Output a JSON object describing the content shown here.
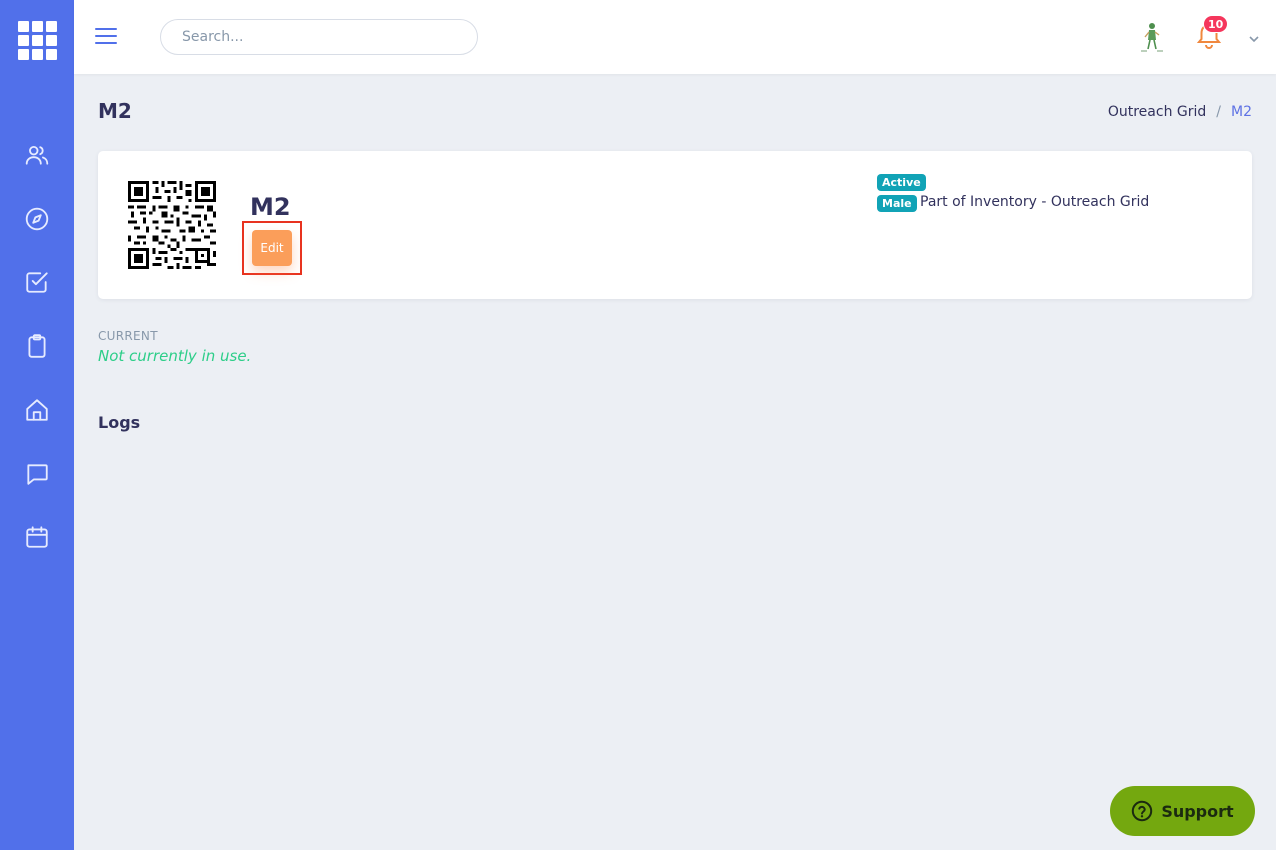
{
  "header": {
    "search_placeholder": "Search...",
    "notification_count": "10"
  },
  "sidebar": {
    "items": [
      {
        "name": "users-icon"
      },
      {
        "name": "compass-icon"
      },
      {
        "name": "checkbox-icon"
      },
      {
        "name": "clipboard-icon"
      },
      {
        "name": "home-icon"
      },
      {
        "name": "chat-icon"
      },
      {
        "name": "calendar-icon"
      }
    ]
  },
  "page": {
    "title": "M2",
    "breadcrumb": {
      "parent": "Outreach Grid",
      "separator": "/",
      "current": "M2"
    }
  },
  "item": {
    "name": "M2",
    "edit_label": "Edit",
    "status": "Active",
    "gender": "Male",
    "inventory": "Part of Inventory - Outreach Grid"
  },
  "current": {
    "label": "CURRENT",
    "value": "Not currently in use."
  },
  "logs": {
    "heading": "Logs"
  },
  "support": {
    "label": "Support"
  },
  "colors": {
    "sidebar": "#5170ea",
    "accent": "#5e72e4",
    "edit_button": "#fb9e5a",
    "tag": "#11a3b6",
    "success": "#2dce89",
    "support": "#74a80f",
    "highlight": "#e8321f"
  }
}
